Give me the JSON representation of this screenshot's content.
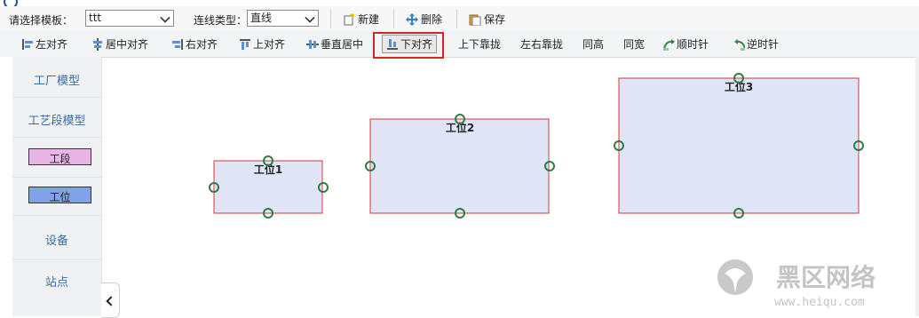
{
  "toolbar": {
    "template_label": "请选择模板：",
    "template_value": "ttt",
    "line_type_label": "连线类型：",
    "line_type_value": "直线",
    "new_label": "新建",
    "delete_label": "删除",
    "save_label": "保存"
  },
  "align_toolbar": {
    "left_align": "左对齐",
    "center_align": "居中对齐",
    "right_align": "右对齐",
    "top_align": "上对齐",
    "vertical_center": "垂直居中",
    "bottom_align": "下对齐",
    "vertical_close": "上下靠拢",
    "horizontal_close": "左右靠拢",
    "same_height": "同高",
    "same_width": "同宽",
    "clockwise": "顺时针",
    "counterclockwise": "逆时针"
  },
  "sidebar": {
    "factory_model": "工厂模型",
    "process_model": "工艺段模型",
    "chip_section": "工段",
    "chip_station": "工位",
    "equipment": "设备",
    "site": "站点"
  },
  "canvas": {
    "nodes": [
      {
        "label": "工位1"
      },
      {
        "label": "工位2"
      },
      {
        "label": "工位3"
      }
    ]
  },
  "watermark": {
    "title": "黑区网络",
    "url": "www.heiqu.com"
  },
  "colors": {
    "node_fill": "#dfe4f7",
    "node_border": "#d43a3a",
    "handle": "#2e7d46",
    "highlight": "#d42424",
    "chip_section": "#e9b4e6",
    "chip_station": "#7fa2e8",
    "link_text": "#3b6ea5"
  }
}
